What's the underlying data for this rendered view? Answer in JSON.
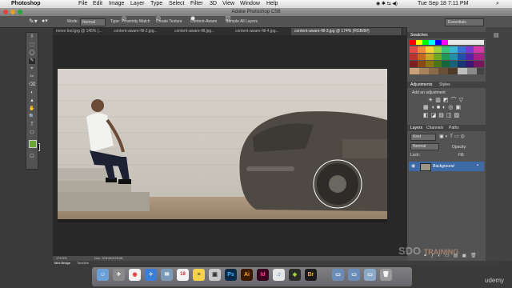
{
  "menubar": {
    "app": "Photoshop",
    "items": [
      "File",
      "Edit",
      "Image",
      "Layer",
      "Type",
      "Select",
      "Filter",
      "3D",
      "View",
      "Window",
      "Help"
    ],
    "clock": "Tue Sep 18  7:11 PM"
  },
  "window": {
    "title": "Adobe Photoshop CS6"
  },
  "options": {
    "mode_label": "Mode:",
    "mode_value": "Normal",
    "type_label": "Type:",
    "proximity": "Proximity Match",
    "create_texture": "Create Texture",
    "content_aware": "Content-Aware",
    "sample_all": "Sample All Layers",
    "workspace": "Essentials"
  },
  "tabs": [
    {
      "label": "move tool.jpg @ 145% (..."
    },
    {
      "label": "content-aware-fill-2.jpg..."
    },
    {
      "label": "content-aware-fill.jpg..."
    },
    {
      "label": "content-aware-fill-4.jpg..."
    },
    {
      "label": "content-aware-fill-3.jpg @ 174% (RGB/8#)"
    }
  ],
  "tools": [
    "⇳",
    "⬚",
    "◯",
    "✎",
    "⌖",
    "✂",
    "⌫",
    "◐",
    "▲",
    "✋",
    "🔍",
    "T",
    "⬠",
    "☐"
  ],
  "colors": {
    "foreground": "#6aa63a",
    "background": "#111111"
  },
  "panels": {
    "swatches_tab": "Swatches",
    "adjustments_tab": "Adjustments",
    "styles_tab": "Styles",
    "add_adjustment": "Add an adjustment",
    "layers_tab": "Layers",
    "channels_tab": "Channels",
    "paths_tab": "Paths",
    "kind_label": "Kind",
    "blend_mode": "Normal",
    "opacity_label": "Opacity:",
    "lock_label": "Lock:",
    "fill_label": "Fill:",
    "layer_name": "Background"
  },
  "status": {
    "zoom": "174.3%",
    "doc": "Doc: 378.0K/378.0K"
  },
  "bottom": {
    "minibridge": "Mini Bridge",
    "timeline": "Timeline"
  },
  "dock": {
    "ps": "Ps",
    "ai": "Ai",
    "id": "Id",
    "br": "Br",
    "calendar_day": "18"
  },
  "watermark": {
    "line1": "SDO",
    "line2": "TRAINING",
    "brand": "udemy"
  }
}
